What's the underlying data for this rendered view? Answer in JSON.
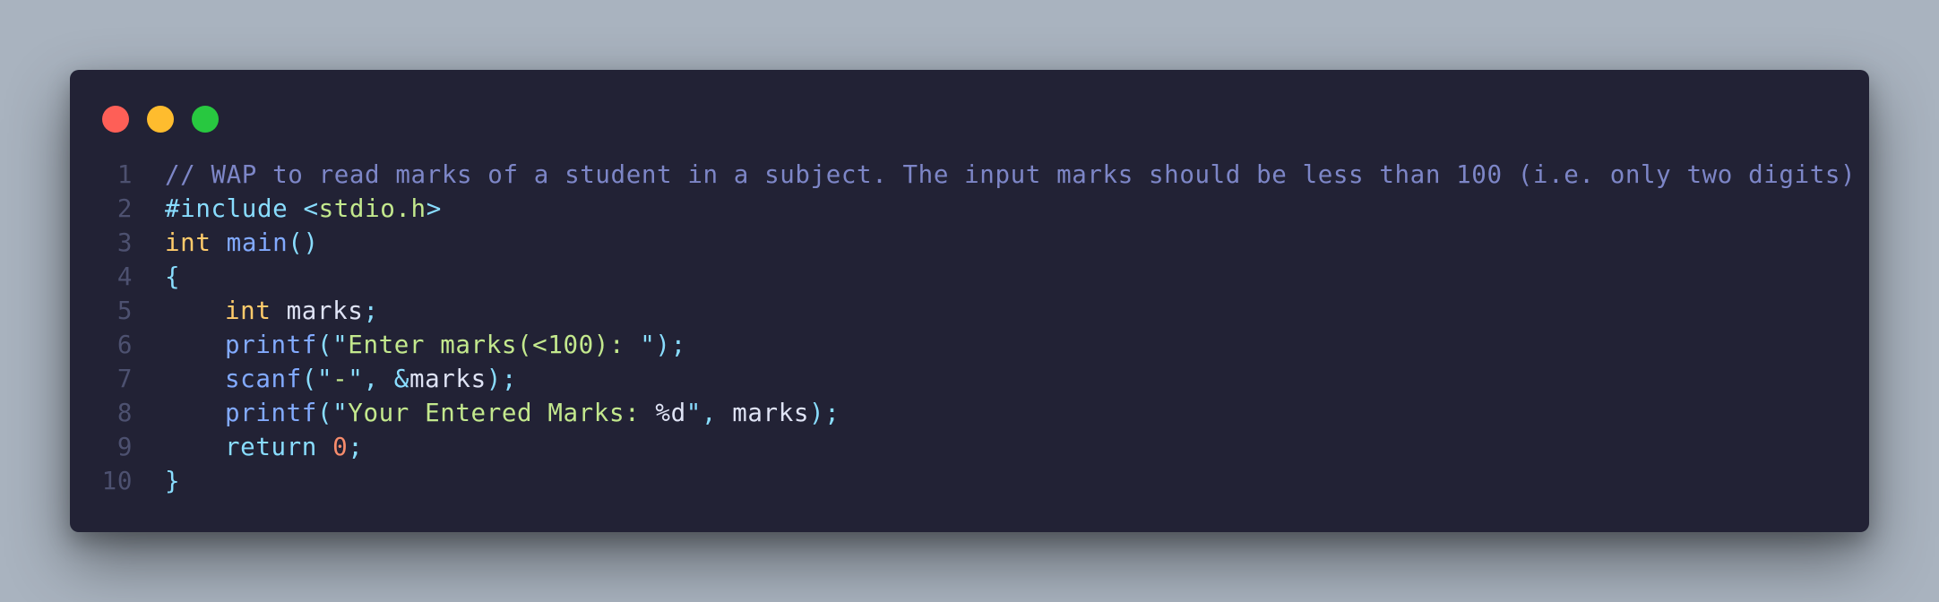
{
  "colors": {
    "background": "#a9b3bf",
    "window": "#222235",
    "close": "#fe5f57",
    "minimize": "#febc2e",
    "maximize": "#28c840",
    "line_number": "#4d5170",
    "comment": "#7d86c7",
    "keyword": "#ffcb6b",
    "function": "#82aaff",
    "punctuation": "#89ddff",
    "string": "#c3e88d",
    "plain": "#dfe3f5",
    "number": "#f78c6c"
  },
  "window": {
    "controls": [
      "close",
      "minimize",
      "maximize"
    ]
  },
  "code": {
    "lines": [
      {
        "number": "1",
        "indent": false,
        "tokens": [
          {
            "text": "// WAP to read marks of a student in a subject. The input marks should be less than 100 (i.e. only two digits)",
            "type": "comment"
          }
        ]
      },
      {
        "number": "2",
        "indent": false,
        "tokens": [
          {
            "text": "#include",
            "type": "punctuation"
          },
          {
            "text": " ",
            "type": "plain"
          },
          {
            "text": "<",
            "type": "punctuation"
          },
          {
            "text": "stdio.h",
            "type": "string"
          },
          {
            "text": ">",
            "type": "punctuation"
          }
        ]
      },
      {
        "number": "3",
        "indent": false,
        "tokens": [
          {
            "text": "int",
            "type": "keyword"
          },
          {
            "text": " ",
            "type": "plain"
          },
          {
            "text": "main",
            "type": "function"
          },
          {
            "text": "()",
            "type": "punctuation"
          }
        ]
      },
      {
        "number": "4",
        "indent": false,
        "tokens": [
          {
            "text": "{",
            "type": "punctuation"
          }
        ]
      },
      {
        "number": "5",
        "indent": true,
        "tokens": [
          {
            "text": "int",
            "type": "keyword"
          },
          {
            "text": " marks",
            "type": "plain"
          },
          {
            "text": ";",
            "type": "punctuation"
          }
        ]
      },
      {
        "number": "6",
        "indent": true,
        "tokens": [
          {
            "text": "printf",
            "type": "function"
          },
          {
            "text": "(\"",
            "type": "punctuation"
          },
          {
            "text": "Enter marks(<100): ",
            "type": "string"
          },
          {
            "text": "\");",
            "type": "punctuation"
          }
        ]
      },
      {
        "number": "7",
        "indent": true,
        "tokens": [
          {
            "text": "scanf",
            "type": "function"
          },
          {
            "text": "(\"",
            "type": "punctuation"
          },
          {
            "text": "-",
            "type": "string"
          },
          {
            "text": "\", &",
            "type": "punctuation"
          },
          {
            "text": "marks",
            "type": "plain"
          },
          {
            "text": ");",
            "type": "punctuation"
          }
        ]
      },
      {
        "number": "8",
        "indent": true,
        "tokens": [
          {
            "text": "printf",
            "type": "function"
          },
          {
            "text": "(\"",
            "type": "punctuation"
          },
          {
            "text": "Your Entered Marks: ",
            "type": "string"
          },
          {
            "text": "%d",
            "type": "plain"
          },
          {
            "text": "\", ",
            "type": "punctuation"
          },
          {
            "text": "marks",
            "type": "plain"
          },
          {
            "text": ");",
            "type": "punctuation"
          }
        ]
      },
      {
        "number": "9",
        "indent": true,
        "tokens": [
          {
            "text": "return",
            "type": "punctuation"
          },
          {
            "text": " ",
            "type": "plain"
          },
          {
            "text": "0",
            "type": "number"
          },
          {
            "text": ";",
            "type": "punctuation"
          }
        ]
      },
      {
        "number": "10",
        "indent": false,
        "tokens": [
          {
            "text": "}",
            "type": "punctuation"
          }
        ]
      }
    ]
  }
}
